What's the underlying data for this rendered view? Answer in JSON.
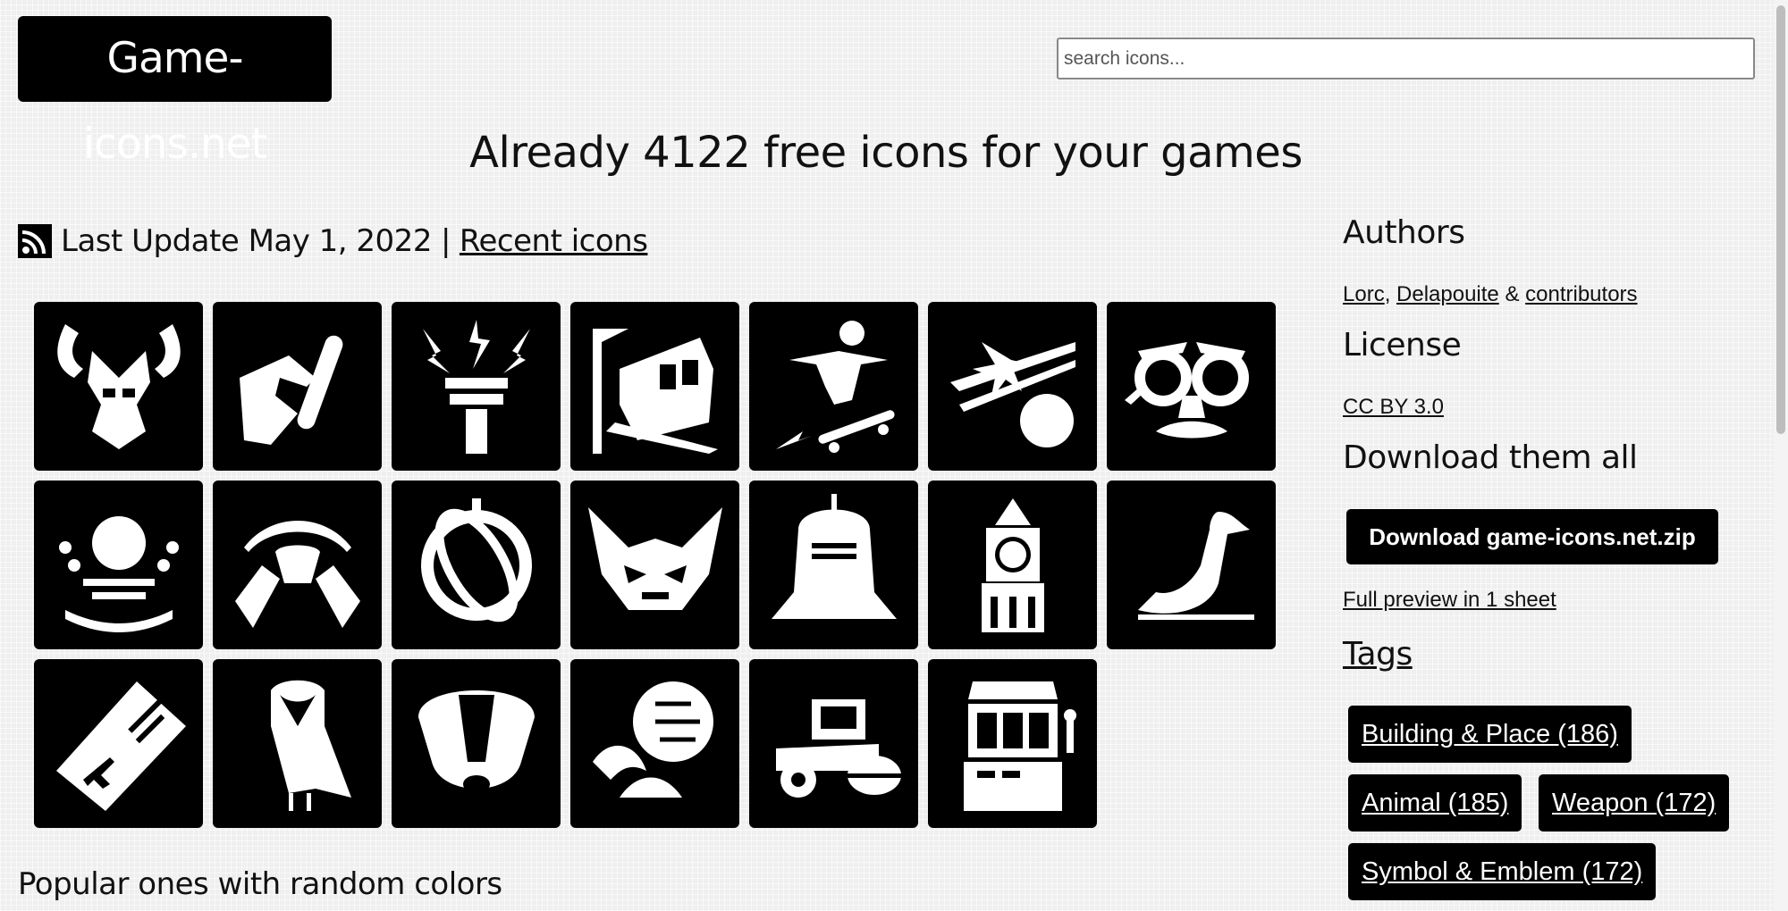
{
  "header": {
    "logo_text": "Game-icons.net",
    "search_placeholder": "search icons..."
  },
  "headline": "Already 4122 free icons for your games",
  "update": {
    "rss_icon": "rss-icon",
    "text": "Last Update May 1, 2022",
    "separator": "|",
    "recent_link": "Recent icons"
  },
  "icons": [
    {
      "name": "horned-helm-icon"
    },
    {
      "name": "hand-test-tube-icon"
    },
    {
      "name": "lightning-tower-icon"
    },
    {
      "name": "train-tunnel-icon"
    },
    {
      "name": "skateboarder-icon"
    },
    {
      "name": "comet-icon"
    },
    {
      "name": "groucho-glasses-icon"
    },
    {
      "name": "plasma-orb-icon"
    },
    {
      "name": "mole-icon"
    },
    {
      "name": "orbit-icon"
    },
    {
      "name": "goblin-head-icon"
    },
    {
      "name": "knight-helmet-icon"
    },
    {
      "name": "clock-tower-icon"
    },
    {
      "name": "goose-icon"
    },
    {
      "name": "plane-ticket-icon"
    },
    {
      "name": "barn-owl-icon"
    },
    {
      "name": "badger-icon"
    },
    {
      "name": "artichoke-icon"
    },
    {
      "name": "road-roller-icon"
    },
    {
      "name": "slot-machine-icon"
    }
  ],
  "popular_heading": "Popular ones with random colors",
  "sidebar": {
    "authors_heading": "Authors",
    "author1": "Lorc",
    "comma": ",",
    "author2": "Delapouite",
    "amp": "&",
    "contributors": "contributors",
    "license_heading": "License",
    "license_link": "CC BY 3.0",
    "download_heading": "Download them all",
    "download_button": "Download game-icons.net.zip",
    "preview_link": "Full preview in 1 sheet",
    "tags_heading": "Tags",
    "tags": [
      {
        "label": "Building & Place (186)"
      },
      {
        "label": "Animal (185)"
      },
      {
        "label": "Weapon (172)"
      },
      {
        "label": "Symbol & Emblem (172)"
      }
    ]
  }
}
